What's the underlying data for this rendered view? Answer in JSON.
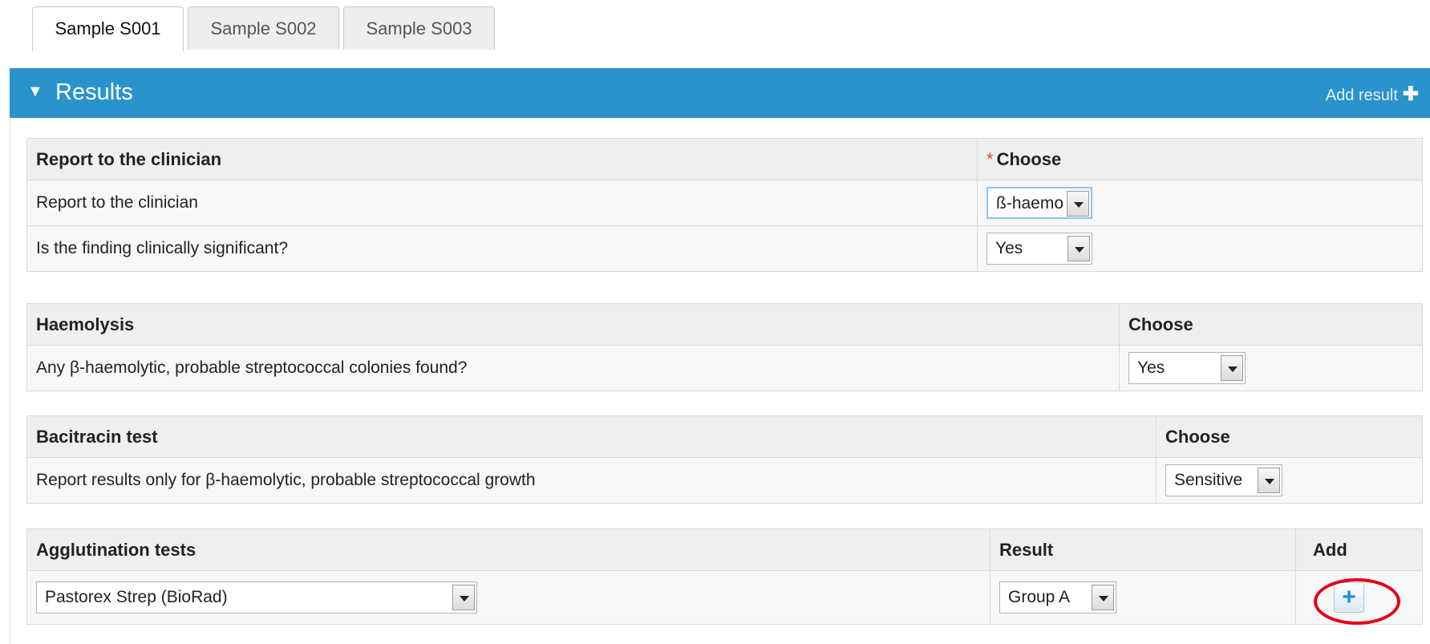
{
  "tabs": [
    {
      "label": "Sample S001",
      "active": true
    },
    {
      "label": "Sample S002",
      "active": false
    },
    {
      "label": "Sample S003",
      "active": false
    }
  ],
  "panel": {
    "title": "Results",
    "add_result_label": "Add result",
    "accent_color": "#2b93cb"
  },
  "sections": {
    "report": {
      "header": "Report to the clinician",
      "choose_label": "Choose",
      "required_marker": "*",
      "rows": [
        {
          "label": "Report to the clinician",
          "value": "ß-haemo"
        },
        {
          "label": "Is the finding clinically significant?",
          "value": "Yes"
        }
      ]
    },
    "haemolysis": {
      "header": "Haemolysis",
      "choose_label": "Choose",
      "rows": [
        {
          "label": "Any β-haemolytic, probable streptococcal colonies found?",
          "value": "Yes"
        }
      ]
    },
    "bacitracin": {
      "header": "Bacitracin test",
      "choose_label": "Choose",
      "rows": [
        {
          "label": "Report results only for β-haemolytic, probable streptococcal growth",
          "value": "Sensitive"
        }
      ]
    },
    "agglutination": {
      "header": "Agglutination tests",
      "result_label": "Result",
      "add_label": "Add",
      "test_value": "Pastorex Strep (BioRad)",
      "result_value": "Group A",
      "add_icon": "plus-icon"
    }
  },
  "icons": {
    "collapse": "caret-down-icon",
    "add_result": "plus-icon",
    "dropdown": "chevron-down-icon"
  }
}
